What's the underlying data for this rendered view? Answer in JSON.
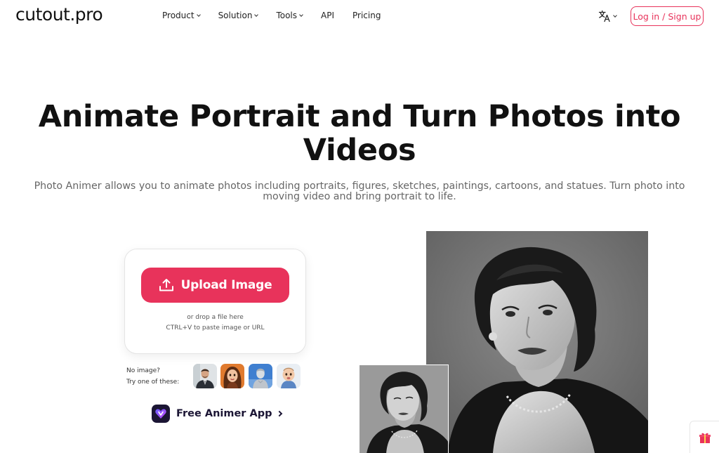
{
  "header": {
    "logo": "cutout.pro",
    "nav": [
      {
        "label": "Product",
        "has_dropdown": true
      },
      {
        "label": "Solution",
        "has_dropdown": true
      },
      {
        "label": "Tools",
        "has_dropdown": true
      },
      {
        "label": "API",
        "has_dropdown": false
      },
      {
        "label": "Pricing",
        "has_dropdown": false
      }
    ],
    "language_icon": "translate-icon",
    "login_label": "Log in / Sign up"
  },
  "hero": {
    "title": "Animate Portrait and Turn Photos into Videos",
    "subtitle": "Photo Animer allows you to animate photos including portraits, figures, sketches, paintings, cartoons, and statues. Turn photo into moving video and bring portrait to life."
  },
  "upload": {
    "button_label": "Upload Image",
    "drop_text": "or drop a file here",
    "paste_text": "CTRL+V to paste image or URL"
  },
  "samples": {
    "line1": "No image?",
    "line2": "Try one of these:",
    "items": [
      "man-in-suit-thumbnail",
      "cartoon-girl-thumbnail",
      "statue-thumbnail",
      "baby-thumbnail"
    ]
  },
  "app_promo": {
    "label": "Free Animer App"
  },
  "colors": {
    "accent": "#e8335b",
    "title": "#111111",
    "subtitle": "#666666",
    "app_dark": "#1b1534"
  }
}
